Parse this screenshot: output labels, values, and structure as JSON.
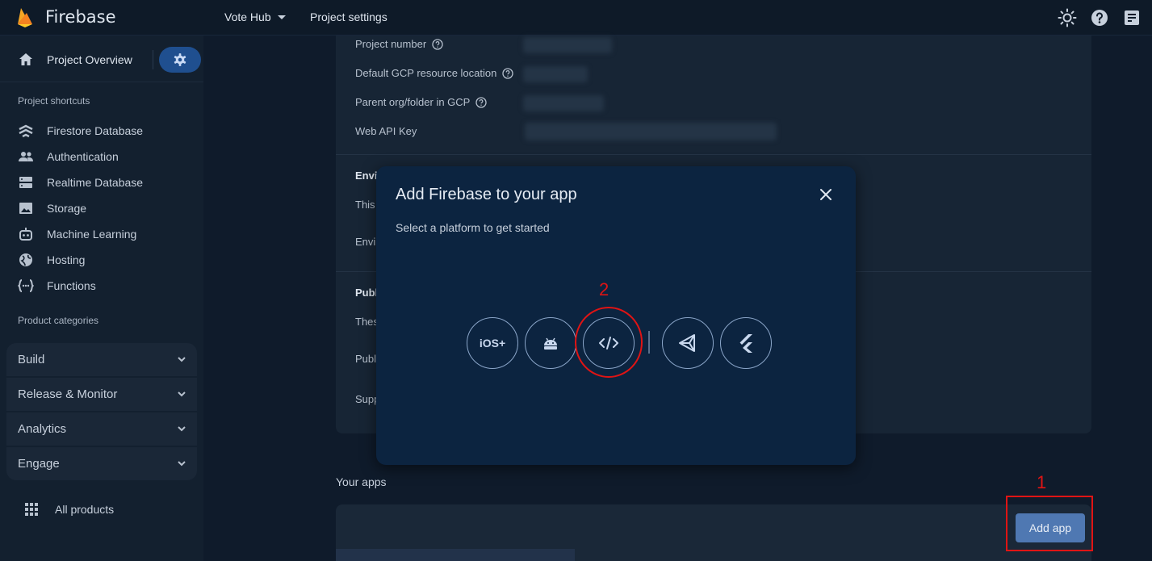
{
  "brand": {
    "name": "Firebase"
  },
  "topbar": {
    "project_name": "Vote Hub",
    "project_settings": "Project settings",
    "icons": [
      "theme-icon",
      "help-icon",
      "notes-icon"
    ]
  },
  "sidebar": {
    "overview_label": "Project Overview",
    "shortcuts_title": "Project shortcuts",
    "shortcuts": [
      {
        "label": "Firestore Database",
        "icon": "firestore-icon"
      },
      {
        "label": "Authentication",
        "icon": "people-icon"
      },
      {
        "label": "Realtime Database",
        "icon": "database-icon"
      },
      {
        "label": "Storage",
        "icon": "storage-icon"
      },
      {
        "label": "Machine Learning",
        "icon": "robot-icon"
      },
      {
        "label": "Hosting",
        "icon": "globe-icon"
      },
      {
        "label": "Functions",
        "icon": "functions-icon"
      }
    ],
    "categories_title": "Product categories",
    "categories": [
      {
        "label": "Build"
      },
      {
        "label": "Release & Monitor"
      },
      {
        "label": "Analytics"
      },
      {
        "label": "Engage"
      }
    ],
    "all_products": "All products"
  },
  "settings": {
    "fields": [
      {
        "label": "Project number"
      },
      {
        "label": "Default GCP resource location"
      },
      {
        "label": "Parent org/folder in GCP"
      },
      {
        "label": "Web API Key"
      }
    ],
    "peek": [
      "Envi",
      "This",
      "Envi",
      "Publ",
      "Thes",
      "Publ",
      "Supp"
    ]
  },
  "apps": {
    "title": "Your apps",
    "add_button": "Add app"
  },
  "dialog": {
    "title": "Add Firebase to your app",
    "subtitle": "Select a platform to get started",
    "platforms": [
      {
        "label": "iOS+",
        "icon": "ios-icon"
      },
      {
        "label": "Android",
        "icon": "android-icon"
      },
      {
        "label": "Web",
        "icon": "web-code-icon"
      },
      {
        "label": "Unity",
        "icon": "unity-icon"
      },
      {
        "label": "Flutter",
        "icon": "flutter-icon"
      }
    ]
  },
  "annotations": {
    "step1": "1",
    "step2": "2",
    "color": "#e01414"
  },
  "colors": {
    "accent": "#1f4f8f",
    "button": "#4f78b2",
    "dialog_bg": "#0c2440"
  }
}
